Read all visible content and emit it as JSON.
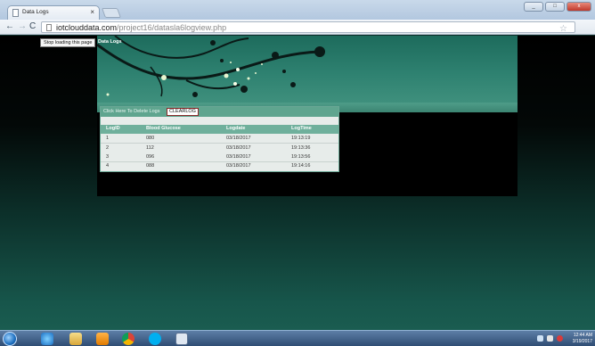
{
  "browser": {
    "tab_title": "Data Logs",
    "tab_close": "×",
    "url_host": "iotclouddata.com",
    "url_path": "/project16/datasla6logview.php",
    "window_buttons": [
      "_",
      "□",
      "x"
    ]
  },
  "page": {
    "status_tooltip": "Stop loading this page",
    "heading": "Data Logs",
    "delete_label": "Click Here To Delete Logs",
    "clear_button": "CLEARLOG",
    "table": {
      "headers": [
        "LogID",
        "Blood Glucose",
        "Logdate",
        "LogTime"
      ],
      "rows": [
        [
          "1",
          "080",
          "03/18/2017",
          "19:13:19"
        ],
        [
          "2",
          "112",
          "03/18/2017",
          "19:13:36"
        ],
        [
          "3",
          "096",
          "03/18/2017",
          "19:13:56"
        ],
        [
          "4",
          "088",
          "03/18/2017",
          "19:14:16"
        ]
      ]
    }
  },
  "taskbar": {
    "icons": [
      "start-orb-icon",
      "ie-icon",
      "folder-icon",
      "media-player-icon",
      "chrome-icon",
      "skype-icon",
      "window-icon"
    ],
    "clock_time": "12:44 AM",
    "clock_date": "3/19/2017"
  },
  "colors": {
    "banner": "#2e8170",
    "table_header": "#6fb09c",
    "clear_button_border": "#8a2a2a"
  }
}
